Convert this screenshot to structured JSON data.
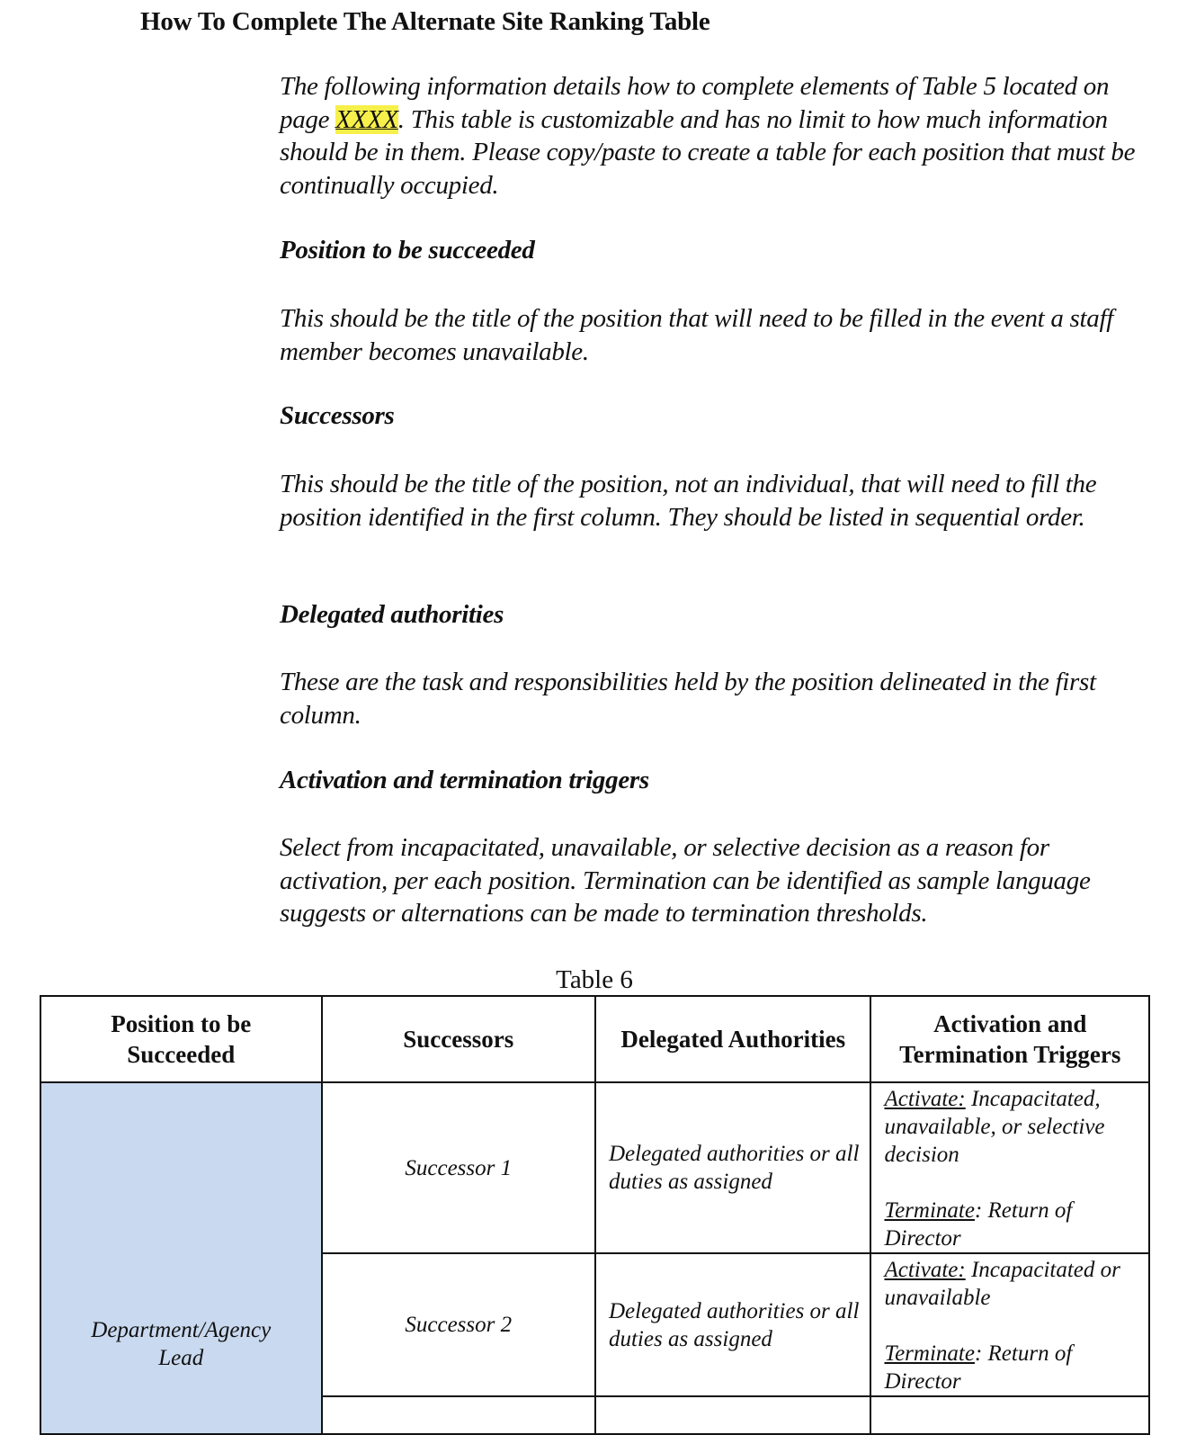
{
  "document": {
    "title": "How To Complete The Alternate Site Ranking Table",
    "intro": {
      "before_highlight": "The following information details how to complete elements of Table 5 located on page ",
      "highlight": "XXXX",
      "after_highlight": ". This table is customizable and has no limit to how much information should be in them. Please copy/paste to create a table for each position that must be continually occupied."
    },
    "sections": [
      {
        "heading": "Position to be succeeded",
        "body": "This should be the title of the position that will need to be filled in the event a staff member becomes unavailable."
      },
      {
        "heading": "Successors",
        "body": "This should be the title of the position, not an individual, that will need to fill the position identified in the first column. They should be listed in sequential order."
      },
      {
        "heading": "Delegated authorities",
        "body": "These are the task and responsibilities held by the position delineated in the first column."
      },
      {
        "heading": "Activation and termination triggers",
        "body": "Select from incapacitated, unavailable, or selective decision as a reason for activation, per each position. Termination can be identified as sample language suggests or alternations can be made to termination thresholds."
      }
    ],
    "highlight_color": "#f6f04a"
  },
  "table": {
    "caption": "Table 6",
    "headers": [
      "Position to be Succeeded",
      "Successors",
      "Delegated Authorities",
      "Activation and Termination Triggers"
    ],
    "position": "Department/Agency Lead",
    "position_cell_color": "#c9d9ef",
    "rows": [
      {
        "successor": "Successor 1",
        "authorities": "Delegated authorities or all duties as assigned",
        "activate_label": "Activate:",
        "activate_text": " Incapacitated, unavailable, or selective decision",
        "terminate_label": "Terminate",
        "terminate_text": ": Return of Director"
      },
      {
        "successor": "Successor 2",
        "authorities": "Delegated authorities or all duties as assigned",
        "activate_label": "Activate:",
        "activate_text": " Incapacitated or unavailable",
        "terminate_label": "Terminate",
        "terminate_text": ": Return of Director"
      }
    ]
  }
}
